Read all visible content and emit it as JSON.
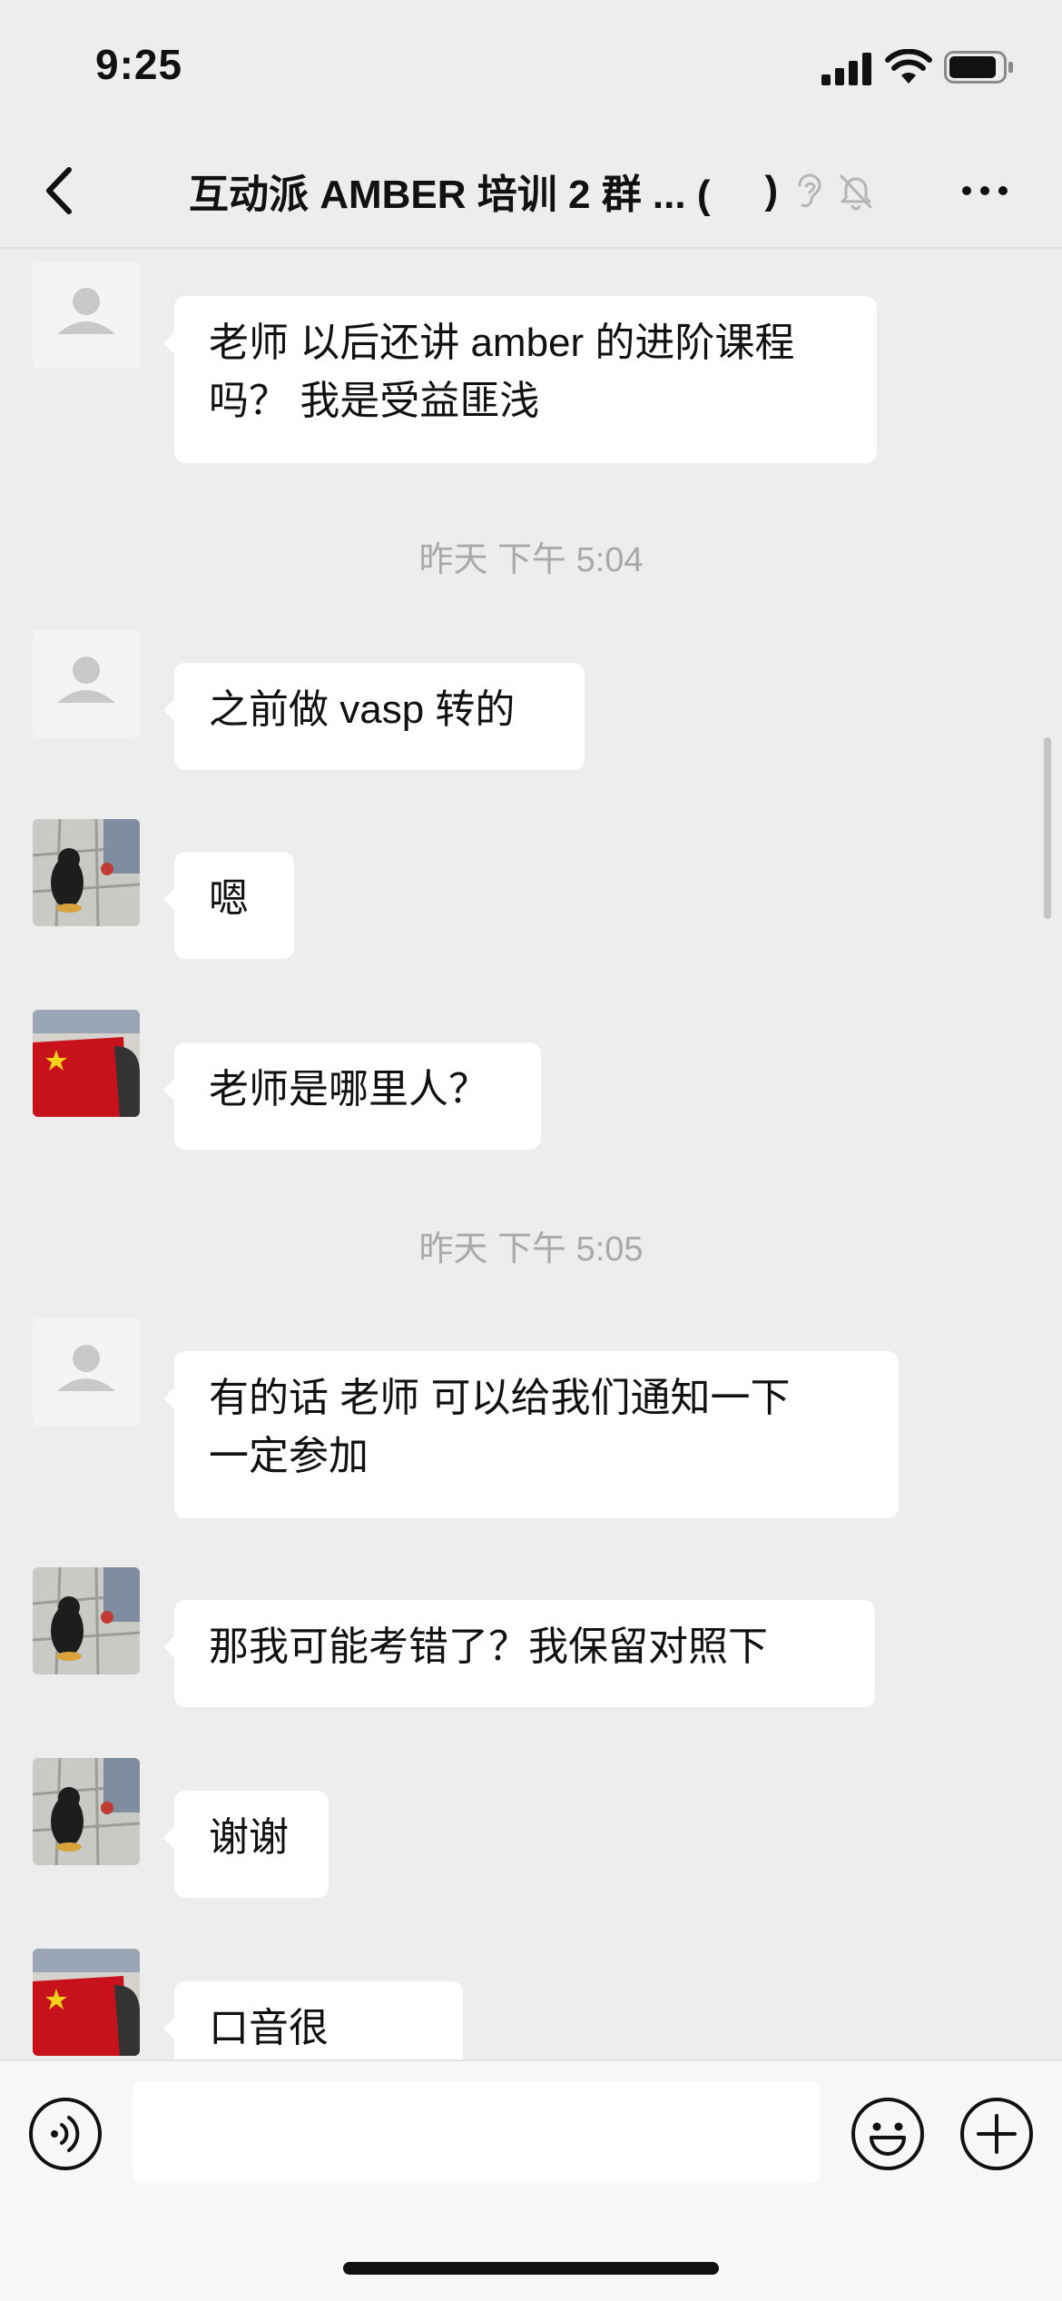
{
  "status_bar": {
    "time": "9:25"
  },
  "nav": {
    "title": "互动派 AMBER 培训 2 群 ... (",
    "title_paren": ")"
  },
  "messages": [
    {
      "avatar": "default-avatar",
      "text_lines": [
        "老师 以后还讲 amber 的进阶课程",
        "吗？ 我是受益匪浅"
      ]
    },
    {
      "timestamp": "昨天 下午 5:04"
    },
    {
      "avatar": "default-avatar",
      "text_lines": [
        "之前做 vasp 转的"
      ]
    },
    {
      "avatar": "penguin-avatar",
      "text_lines": [
        "嗯"
      ]
    },
    {
      "avatar": "flag-avatar",
      "text_lines": [
        "老师是哪里人？"
      ]
    },
    {
      "timestamp": "昨天 下午 5:05"
    },
    {
      "avatar": "default-avatar",
      "text_lines": [
        "有的话 老师 可以给我们通知一下",
        "一定参加"
      ]
    },
    {
      "avatar": "penguin-avatar",
      "text_lines": [
        "那我可能考错了？我保留对照下"
      ]
    },
    {
      "avatar": "penguin-avatar",
      "text_lines": [
        "谢谢"
      ]
    },
    {
      "avatar": "flag-avatar",
      "text_lines": [
        "口音很"
      ]
    }
  ],
  "input": {
    "value": "",
    "placeholder": ""
  },
  "colors": {
    "background": "#ededed",
    "bubble": "#ffffff",
    "timestamp": "#a9a9a9"
  }
}
